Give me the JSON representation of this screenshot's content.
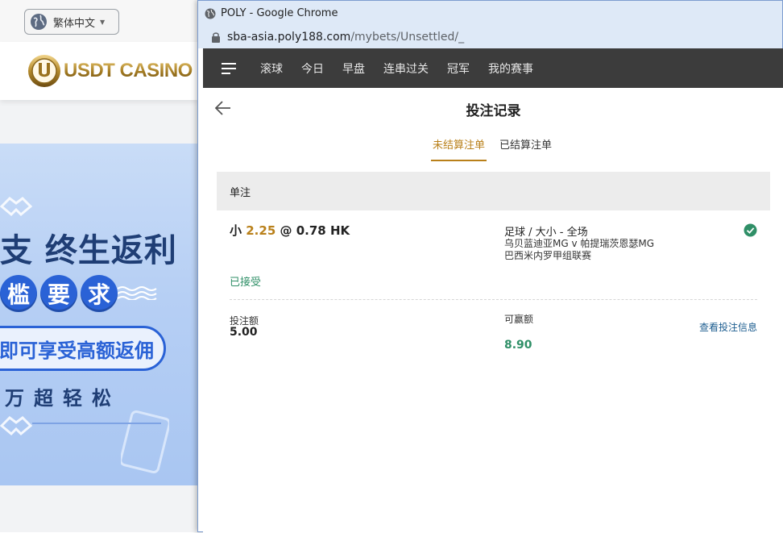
{
  "background_site": {
    "language_label": "繁体中文",
    "logo_text": "USDT CASINO",
    "banner": {
      "line1": "支 终生返利",
      "pills": [
        "槛",
        "要",
        "求"
      ],
      "oval_text": "即可享受高额返佣",
      "line4": "万超轻松"
    }
  },
  "browser": {
    "window_title": "POLY - Google Chrome",
    "url_host": "sba-asia.poly188.com",
    "url_path": "/mybets/Unsettled/_"
  },
  "nav": {
    "items": [
      "滚球",
      "今日",
      "早盘",
      "连串过关",
      "冠军",
      "我的赛事"
    ]
  },
  "page": {
    "title": "投注记录",
    "tabs": [
      {
        "label": "未结算注单",
        "active": true
      },
      {
        "label": "已结算注单",
        "active": false
      }
    ]
  },
  "bets": {
    "section_label": "单注",
    "bet": {
      "selection": "小",
      "line": "2.25",
      "at": "@",
      "odds": "0.78 HK",
      "market": "足球 / 大小 - 全场",
      "match": "乌贝蓝迪亚MG v 帕提瑞茨恩瑟MG",
      "league": "巴西米内罗甲组联赛",
      "status": "已接受",
      "stake_label": "投注额",
      "stake_value": "5.00",
      "win_label": "可赢额",
      "win_value": "8.90",
      "details_link": "查看投注信息"
    }
  },
  "colors": {
    "accent_gold": "#b9801a",
    "accent_green": "#2f8f67",
    "nav_bg": "#3c3c3c",
    "link_blue": "#1b5c8f"
  }
}
